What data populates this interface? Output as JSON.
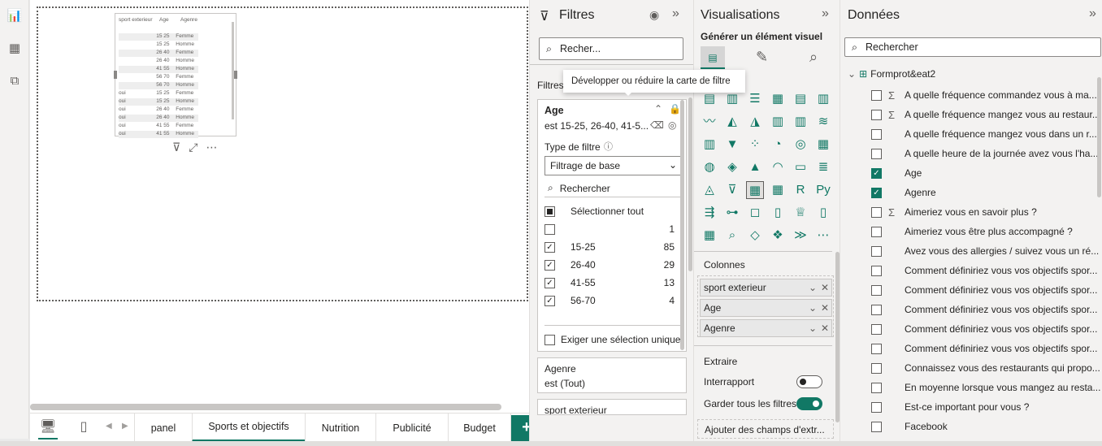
{
  "canvas": {
    "table": {
      "headers": [
        "sport exterieur",
        "Age",
        "Agenre"
      ],
      "rows": [
        [
          "",
          "15 25",
          "Femme"
        ],
        [
          "",
          "15 25",
          "Homme"
        ],
        [
          "",
          "26 40",
          "Femme"
        ],
        [
          "",
          "26 40",
          "Homme"
        ],
        [
          "",
          "41 55",
          "Homme"
        ],
        [
          "",
          "56 70",
          "Femme"
        ],
        [
          "",
          "56 70",
          "Homme"
        ],
        [
          "oui",
          "15 25",
          "Femme"
        ],
        [
          "oui",
          "15 25",
          "Homme"
        ],
        [
          "oui",
          "26 40",
          "Femme"
        ],
        [
          "oui",
          "26 40",
          "Homme"
        ],
        [
          "oui",
          "41 55",
          "Femme"
        ],
        [
          "oui",
          "41 55",
          "Homme"
        ]
      ]
    }
  },
  "pages": {
    "tabs": [
      "panel",
      "Sports et objectifs",
      "Nutrition",
      "Publicité",
      "Budget"
    ],
    "active": "Sports et objectifs",
    "add": "+"
  },
  "filters": {
    "title": "Filtres",
    "search_placeholder": "Recher...",
    "section_label": "Filtres",
    "tooltip": "Développer ou réduire la carte de filtre",
    "age_card": {
      "title": "Age",
      "summary": "est 15-25, 26-40, 41-5...",
      "filter_type_label": "Type de filtre",
      "filter_type_value": "Filtrage de base",
      "search_placeholder": "Rechercher",
      "select_all": "Sélectionner tout",
      "items": [
        {
          "label": "",
          "count": "1",
          "checked": false
        },
        {
          "label": "15-25",
          "count": "85",
          "checked": true
        },
        {
          "label": "26-40",
          "count": "29",
          "checked": true
        },
        {
          "label": "41-55",
          "count": "13",
          "checked": true
        },
        {
          "label": "56-70",
          "count": "4",
          "checked": true
        }
      ],
      "single_select": "Exiger une sélection unique"
    },
    "agenre_card": {
      "title": "Agenre",
      "summary": "est (Tout)"
    },
    "sport_card": {
      "title": "sport exterieur"
    }
  },
  "visualizations": {
    "title": "Visualisations",
    "build_label": "Générer un élément visuel",
    "columns_label": "Colonnes",
    "columns": [
      "sport exterieur",
      "Age",
      "Agenre"
    ],
    "drill_label": "Extraire",
    "cross_report": "Interrapport",
    "cross_report_on": false,
    "keep_filters": "Garder tous les filtres",
    "keep_filters_on": true,
    "add_drill": "Ajouter des champs d'extr..."
  },
  "data": {
    "title": "Données",
    "search_placeholder": "Rechercher",
    "table_name": "Formprot&eat2",
    "fields": [
      {
        "label": "A quelle fréquence commandez vous à ma...",
        "sigma": true,
        "checked": false
      },
      {
        "label": "A quelle fréquence mangez vous au restaur...",
        "sigma": true,
        "checked": false
      },
      {
        "label": "A quelle fréquence mangez vous dans un r...",
        "sigma": false,
        "checked": false
      },
      {
        "label": "A quelle heure de la journée avez vous l'ha...",
        "sigma": false,
        "checked": false
      },
      {
        "label": "Age",
        "sigma": false,
        "checked": true
      },
      {
        "label": "Agenre",
        "sigma": false,
        "checked": true
      },
      {
        "label": "Aimeriez vous en savoir plus ?",
        "sigma": true,
        "checked": false
      },
      {
        "label": "Aimeriez vous être plus accompagné ?",
        "sigma": false,
        "checked": false
      },
      {
        "label": "Avez vous des allergies / suivez vous un ré...",
        "sigma": false,
        "checked": false
      },
      {
        "label": "Comment définiriez vous vos objectifs spor...",
        "sigma": false,
        "checked": false
      },
      {
        "label": "Comment définiriez vous vos objectifs spor...",
        "sigma": false,
        "checked": false
      },
      {
        "label": "Comment définiriez vous vos objectifs spor...",
        "sigma": false,
        "checked": false
      },
      {
        "label": "Comment définiriez vous vos objectifs spor...",
        "sigma": false,
        "checked": false
      },
      {
        "label": "Comment définiriez vous vos objectifs spor...",
        "sigma": false,
        "checked": false
      },
      {
        "label": "Connaissez vous des restaurants qui propo...",
        "sigma": false,
        "checked": false
      },
      {
        "label": "En moyenne lorsque vous mangez au resta...",
        "sigma": false,
        "checked": false
      },
      {
        "label": "Est-ce important pour vous ?",
        "sigma": false,
        "checked": false
      },
      {
        "label": "Facebook",
        "sigma": false,
        "checked": false
      }
    ]
  },
  "colors": {
    "accent": "#117865",
    "panel": "#f3f2f1",
    "border": "#c8c6c4"
  }
}
